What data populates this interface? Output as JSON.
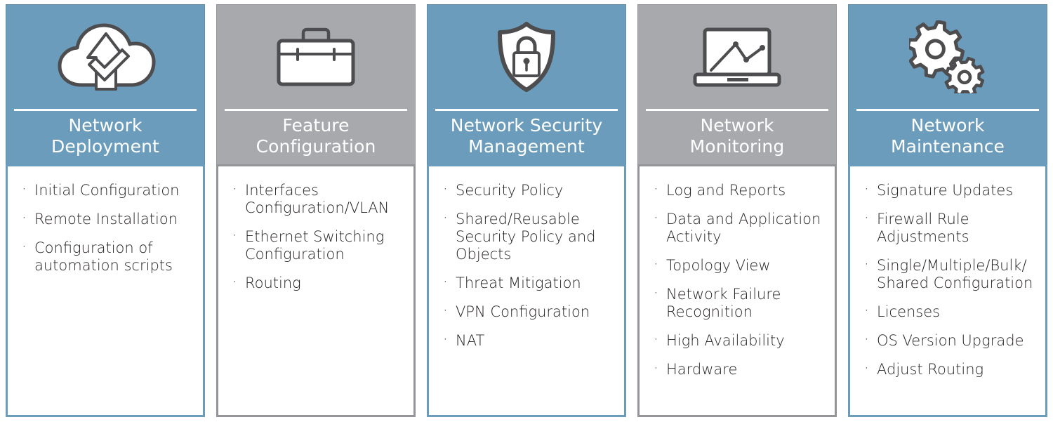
{
  "theme": {
    "blue": "#6b9cbb",
    "gray": "#a7a9ac",
    "gray_border": "#939598",
    "icon_stroke": "#4d4d4f",
    "text_dark": "#231f20",
    "text_light": "#ffffff"
  },
  "columns": [
    {
      "id": "network-deployment",
      "accent": "blue",
      "icon": "cloud-sync-icon",
      "title": "Network\nDeployment",
      "title_line1": "Network",
      "title_line2": "Deployment",
      "items": [
        "Initial Configuration",
        "Remote Installation",
        "Configuration of automation scripts"
      ]
    },
    {
      "id": "feature-configuration",
      "accent": "gray",
      "icon": "toolbox-icon",
      "title": "Feature\nConfiguration",
      "title_line1": "Feature",
      "title_line2": "Configuration",
      "items": [
        "Interfaces Configuration/VLAN",
        "Ethernet Switching Configuration",
        "Routing"
      ]
    },
    {
      "id": "network-security-management",
      "accent": "blue",
      "icon": "shield-lock-icon",
      "title": "Network Security\nManagement",
      "title_line1": "Network Security",
      "title_line2": "Management",
      "items": [
        "Security Policy",
        "Shared/Reusable Security Policy and Objects",
        "Threat Mitigation",
        "VPN Configuration",
        "NAT"
      ]
    },
    {
      "id": "network-monitoring",
      "accent": "gray",
      "icon": "laptop-chart-icon",
      "title": "Network\nMonitoring",
      "title_line1": "Network",
      "title_line2": "Monitoring",
      "items": [
        "Log and Reports",
        "Data and Application Activity",
        "Topology View",
        "Network Failure Recognition",
        "High Availability",
        "Hardware"
      ]
    },
    {
      "id": "network-maintenance",
      "accent": "blue",
      "icon": "gears-icon",
      "title": "Network\nMaintenance",
      "title_line1": "Network",
      "title_line2": "Maintenance",
      "items": [
        "Signature Updates",
        "Firewall Rule Adjustments",
        "Single/Multiple/Bulk/ Shared Configuration",
        "Licenses",
        "OS Version Upgrade",
        "Adjust Routing"
      ]
    }
  ]
}
